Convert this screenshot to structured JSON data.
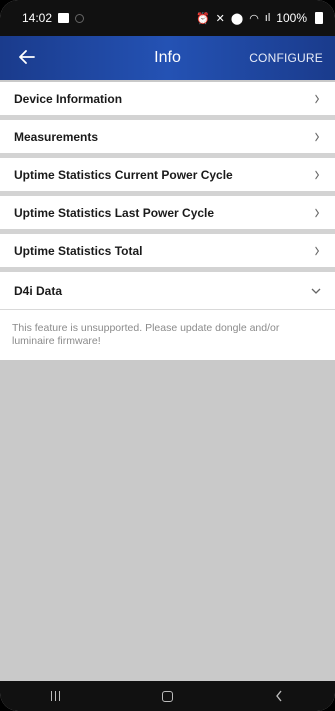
{
  "status_bar": {
    "time": "14:02",
    "signal": "ıl",
    "battery": "100%"
  },
  "app_bar": {
    "title": "Info",
    "action_label": "CONFIGURE",
    "background_color": "#2452b4"
  },
  "sections": [
    {
      "label": "Device Information",
      "expanded": false
    },
    {
      "label": "Measurements",
      "expanded": false
    },
    {
      "label": "Uptime Statistics Current Power Cycle",
      "expanded": false
    },
    {
      "label": "Uptime Statistics Last Power Cycle",
      "expanded": false
    },
    {
      "label": "Uptime Statistics Total",
      "expanded": false
    },
    {
      "label": "D4i Data",
      "expanded": true
    }
  ],
  "d4i": {
    "message": "This feature is unsupported. Please update dongle and/or luminaire firmware!"
  },
  "icons": {
    "back": "arrow-left",
    "collapsed": "chevron-right",
    "expanded": "chevron-down"
  }
}
